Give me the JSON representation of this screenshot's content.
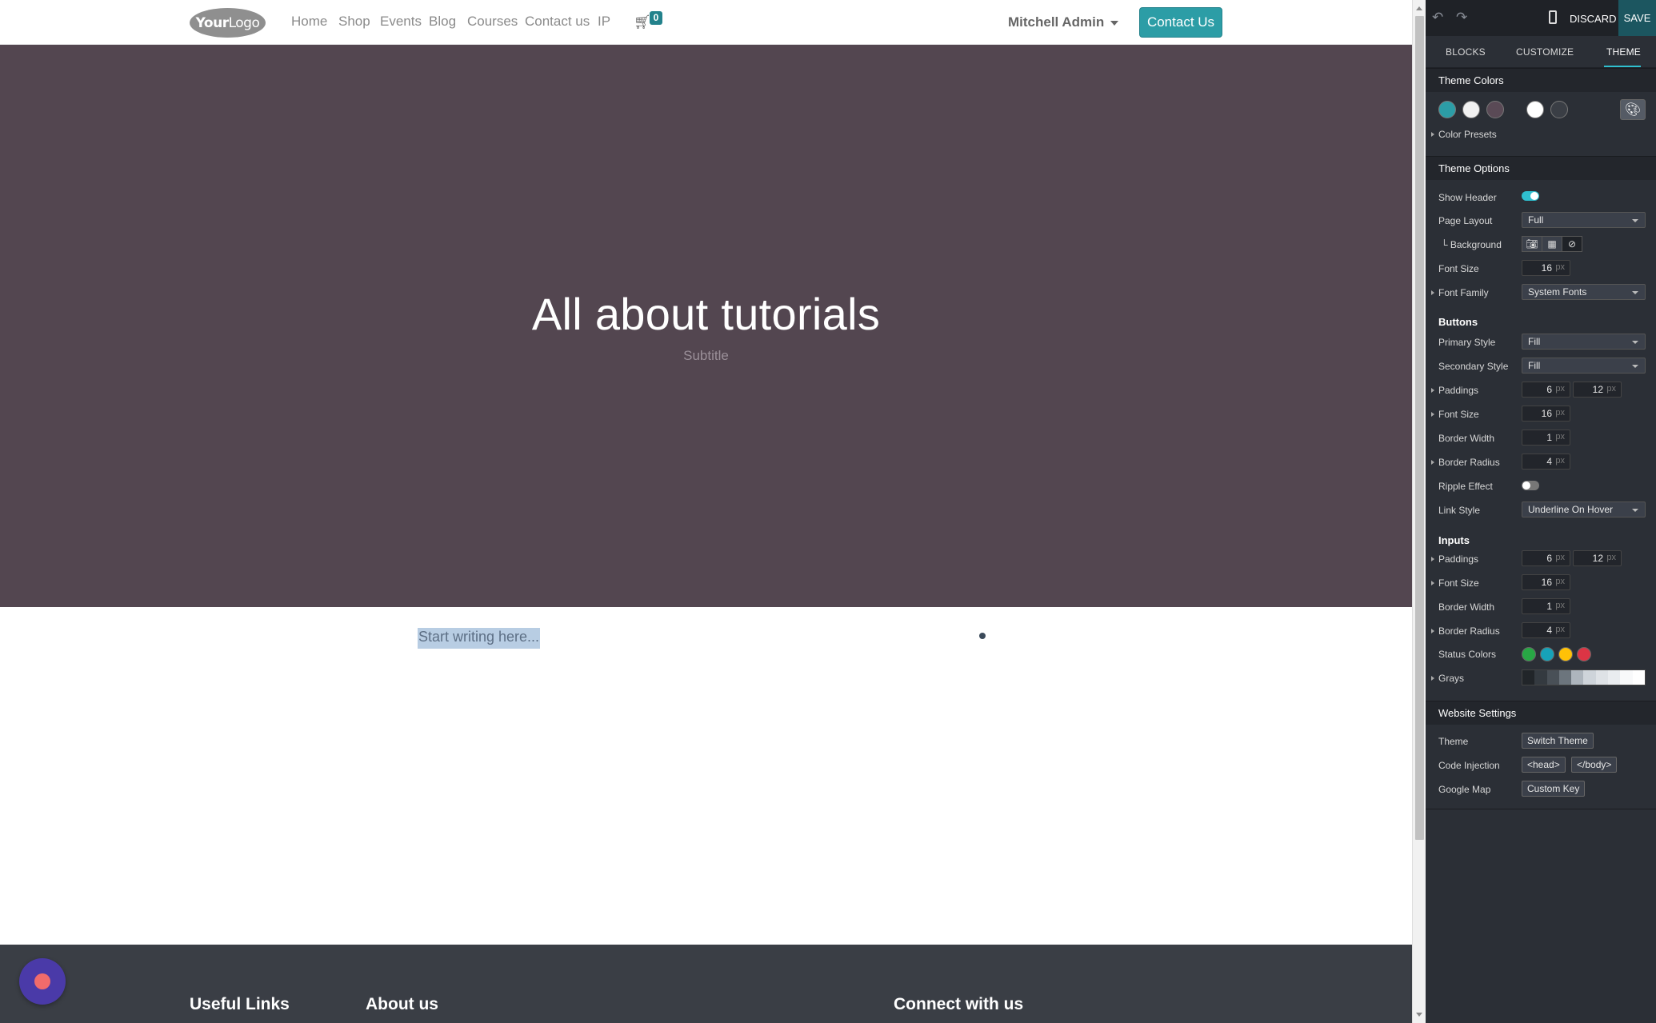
{
  "site": {
    "logo": {
      "bold": "Your",
      "rest": "Logo"
    },
    "menu": [
      "Home",
      "Shop",
      "Events",
      "Blog",
      "Courses",
      "Contact us",
      "IP"
    ],
    "cart_count": "0",
    "user": "Mitchell Admin",
    "cta": "Contact Us",
    "hero": {
      "title": "All about tutorials",
      "subtitle": "Subtitle",
      "bg": "#534650"
    },
    "editable_placeholder": "Start writing here...",
    "footer": {
      "col1": "Useful Links",
      "col2": "About us",
      "col3": "Connect with us"
    }
  },
  "panel": {
    "topbar": {
      "discard": "DISCARD",
      "save": "SAVE"
    },
    "tabs": [
      "BLOCKS",
      "CUSTOMIZE",
      "THEME"
    ],
    "active_tab": "THEME",
    "theme_colors": {
      "title": "Theme Colors",
      "swatches": [
        "#2c9da6",
        "#f1f1f1",
        "#5a4a56",
        "#ffffff",
        "#3a3e45"
      ],
      "presets": "Color Presets"
    },
    "theme_options": {
      "title": "Theme Options",
      "show_header": "Show Header",
      "show_header_on": true,
      "page_layout": {
        "label": "Page Layout",
        "value": "Full"
      },
      "background": "Background",
      "font_size": {
        "label": "Font Size",
        "value": "16",
        "unit": "px"
      },
      "font_family": {
        "label": "Font Family",
        "value": "System Fonts"
      }
    },
    "buttons": {
      "title": "Buttons",
      "primary_style": {
        "label": "Primary Style",
        "value": "Fill"
      },
      "secondary_style": {
        "label": "Secondary Style",
        "value": "Fill"
      },
      "paddings": {
        "label": "Paddings",
        "y": "6",
        "x": "12",
        "unit": "px"
      },
      "font_size": {
        "label": "Font Size",
        "value": "16",
        "unit": "px"
      },
      "border_width": {
        "label": "Border Width",
        "value": "1",
        "unit": "px"
      },
      "border_radius": {
        "label": "Border Radius",
        "value": "4",
        "unit": "px"
      },
      "ripple": {
        "label": "Ripple Effect",
        "on": false
      },
      "link_style": {
        "label": "Link Style",
        "value": "Underline On Hover"
      }
    },
    "inputs": {
      "title": "Inputs",
      "paddings": {
        "label": "Paddings",
        "y": "6",
        "x": "12",
        "unit": "px"
      },
      "font_size": {
        "label": "Font Size",
        "value": "16",
        "unit": "px"
      },
      "border_width": {
        "label": "Border Width",
        "value": "1",
        "unit": "px"
      },
      "border_radius": {
        "label": "Border Radius",
        "value": "4",
        "unit": "px"
      },
      "status_colors": {
        "label": "Status Colors",
        "colors": [
          "#28a745",
          "#17a2b8",
          "#ffc107",
          "#dc3545"
        ]
      },
      "grays": {
        "label": "Grays",
        "colors": [
          "#212529",
          "#343a40",
          "#495057",
          "#6c757d",
          "#adb5bd",
          "#ced4da",
          "#dee2e6",
          "#e9ecef",
          "#f8f9fa",
          "#ffffff"
        ]
      }
    },
    "website_settings": {
      "title": "Website Settings",
      "theme": {
        "label": "Theme",
        "button": "Switch Theme"
      },
      "code_injection": {
        "label": "Code Injection",
        "head": "<head>",
        "body": "</body>"
      },
      "google_map": {
        "label": "Google Map",
        "button": "Custom Key"
      }
    }
  }
}
